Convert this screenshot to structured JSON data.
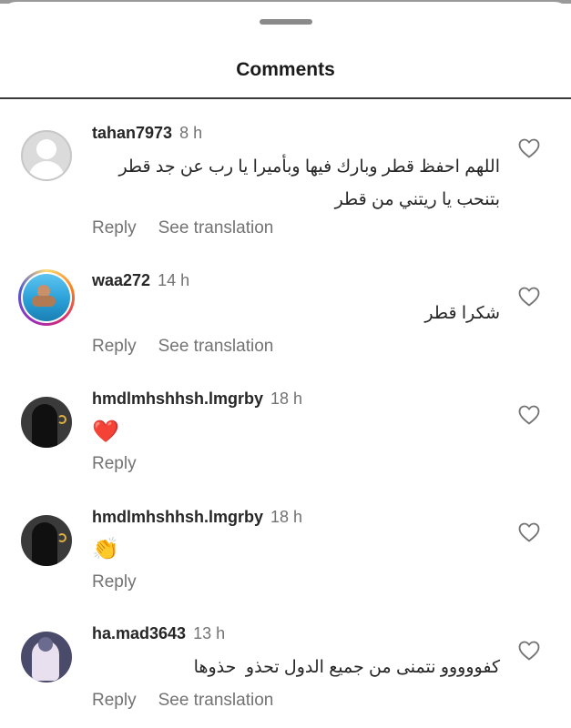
{
  "sheet": {
    "title": "Comments"
  },
  "comments": [
    {
      "username": "tahan7973",
      "time": "8 h",
      "text_lines": [
        "اللهم احفظ قطر وبارك فيها وبأميرا يا رب عن جد قطر",
        "بتنحب يا ريتني من قطر"
      ],
      "actions": [
        "Reply",
        "See translation"
      ],
      "avatar": "default-avatar"
    },
    {
      "username": "waa272",
      "time": "14 h",
      "text_lines": [
        "شكرا قطر"
      ],
      "actions": [
        "Reply",
        "See translation"
      ],
      "avatar": "story-ring-avatar"
    },
    {
      "username": "hmdlmhshhsh.lmgrby",
      "time": "18 h",
      "emoji": "❤️",
      "actions": [
        "Reply"
      ],
      "avatar": "dark-avatar"
    },
    {
      "username": "hmdlmhshhsh.lmgrby",
      "time": "18 h",
      "emoji": "👏",
      "actions": [
        "Reply"
      ],
      "avatar": "dark-avatar"
    },
    {
      "username": "ha.mad3643",
      "time": "13 h",
      "text_lines": [
        "كفووووو نتمنى من جميع الدول تحذو  حذوها"
      ],
      "actions": [
        "Reply",
        "See translation"
      ],
      "avatar": "photo-avatar"
    }
  ],
  "icons": {
    "like": "heart-outline-icon",
    "handle": "drag-handle"
  },
  "colors": {
    "text": "#262626",
    "secondary": "#737373",
    "divider": "#3a3a3a",
    "heart_red": "#ed4956"
  }
}
